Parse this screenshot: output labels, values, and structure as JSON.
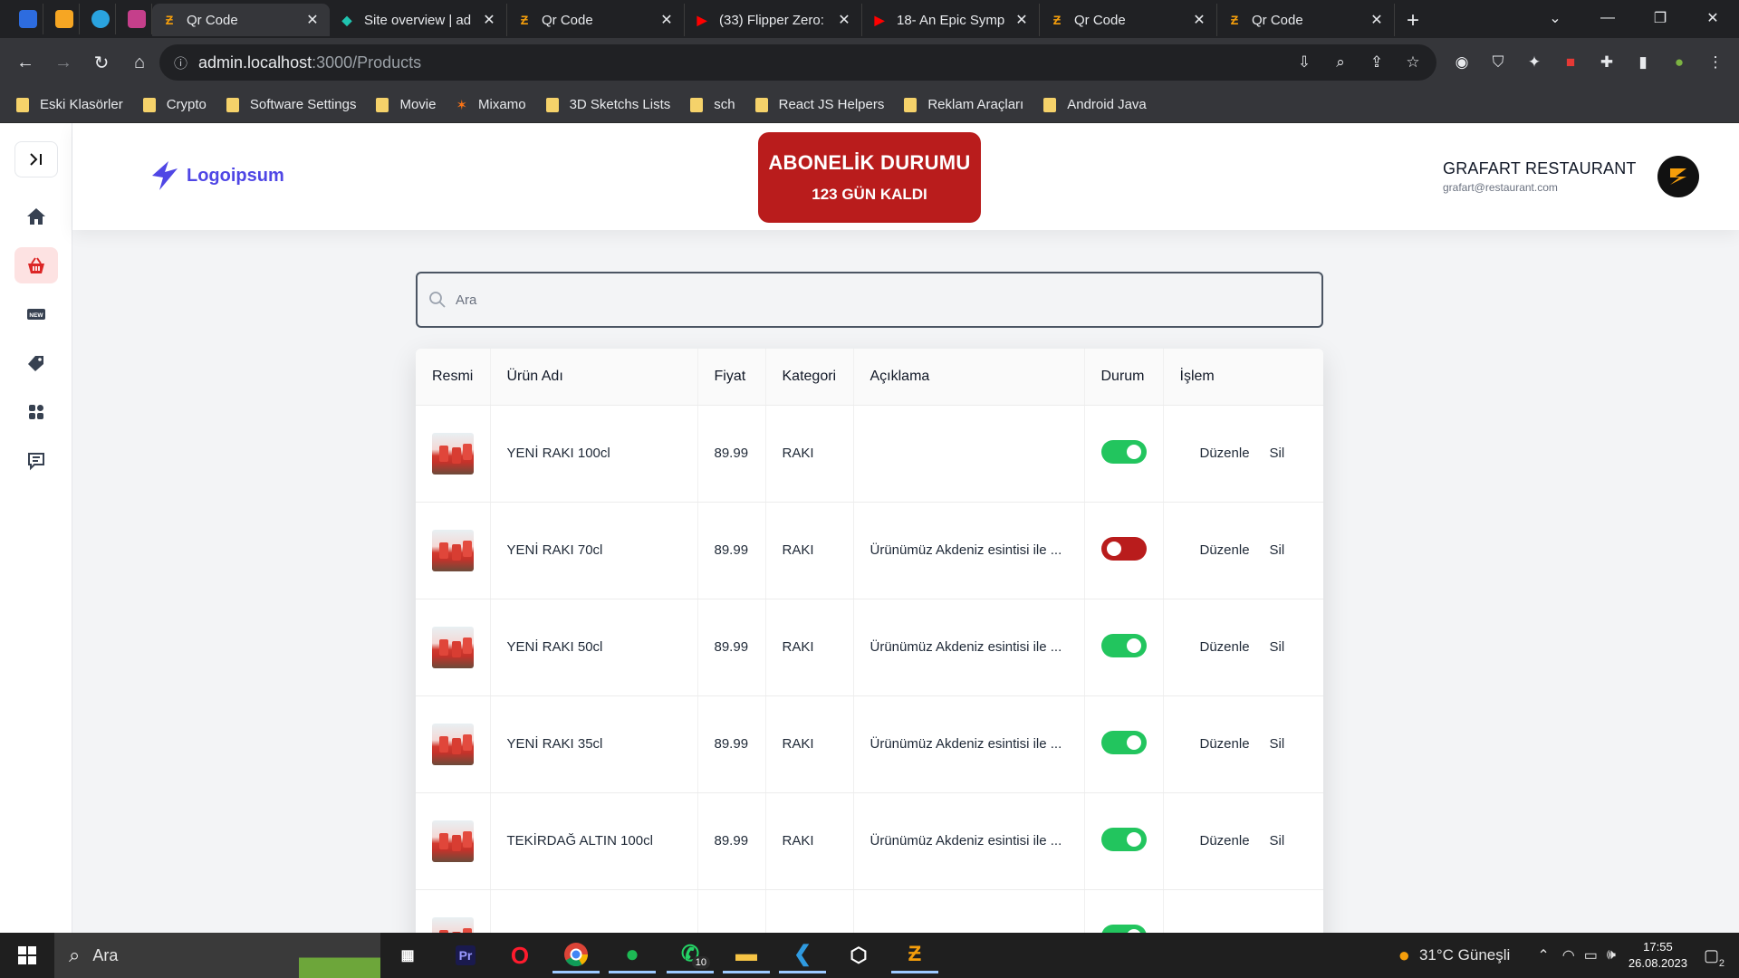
{
  "browser": {
    "tabs": [
      {
        "title": "Qr Code",
        "active": true
      },
      {
        "title": "Site overview | ad",
        "active": false
      },
      {
        "title": "Qr Code",
        "active": false
      },
      {
        "title": "(33) Flipper Zero:",
        "active": false
      },
      {
        "title": "18- An Epic Symp",
        "active": false
      },
      {
        "title": "Qr Code",
        "active": false
      },
      {
        "title": "Qr Code",
        "active": false
      }
    ],
    "address_host": "admin.localhost",
    "address_path": ":3000/Products",
    "bookmarks": [
      "Eski Klasörler",
      "Crypto",
      "Software Settings",
      "Movie",
      "Mixamo",
      "3D Sketchs Lists",
      "sch",
      "React JS Helpers",
      "Reklam Araçları",
      "Android Java"
    ]
  },
  "header": {
    "logo_text": "Logoipsum",
    "subscription_title": "ABONELİK DURUMU",
    "subscription_days": "123 GÜN KALDI",
    "user_name": "GRAFART RESTAURANT",
    "user_email": "grafart@restaurant.com"
  },
  "search": {
    "placeholder": "Ara"
  },
  "table": {
    "columns": [
      "Resmi",
      "Ürün Adı",
      "Fiyat",
      "Kategori",
      "Açıklama",
      "Durum",
      "İşlem"
    ],
    "edit_label": "Düzenle",
    "delete_label": "Sil",
    "rows": [
      {
        "name": "YENİ RAKI 100cl",
        "price": "89.99",
        "category": "RAKI",
        "description": "",
        "active": true
      },
      {
        "name": "YENİ RAKI 70cl",
        "price": "89.99",
        "category": "RAKI",
        "description": "Ürünümüz Akdeniz esintisi ile ...",
        "active": false
      },
      {
        "name": "YENİ RAKI 50cl",
        "price": "89.99",
        "category": "RAKI",
        "description": "Ürünümüz Akdeniz esintisi ile ...",
        "active": true
      },
      {
        "name": "YENİ RAKI 35cl",
        "price": "89.99",
        "category": "RAKI",
        "description": "Ürünümüz Akdeniz esintisi ile ...",
        "active": true
      },
      {
        "name": "TEKİRDAĞ ALTIN 100cl",
        "price": "89.99",
        "category": "RAKI",
        "description": "Ürünümüz Akdeniz esintisi ile ...",
        "active": true
      },
      {
        "name": "",
        "price": "",
        "category": "",
        "description": "",
        "active": true
      }
    ]
  },
  "taskbar": {
    "search_label": "Ara",
    "weather": "31°C  Güneşli",
    "time": "17:55",
    "date": "26.08.2023",
    "whatsapp_badge": "10",
    "notification_count": "2"
  },
  "colors": {
    "accent_red": "#b91c1c",
    "toggle_on": "#22c55e",
    "logo_blue": "#4f46e5"
  }
}
